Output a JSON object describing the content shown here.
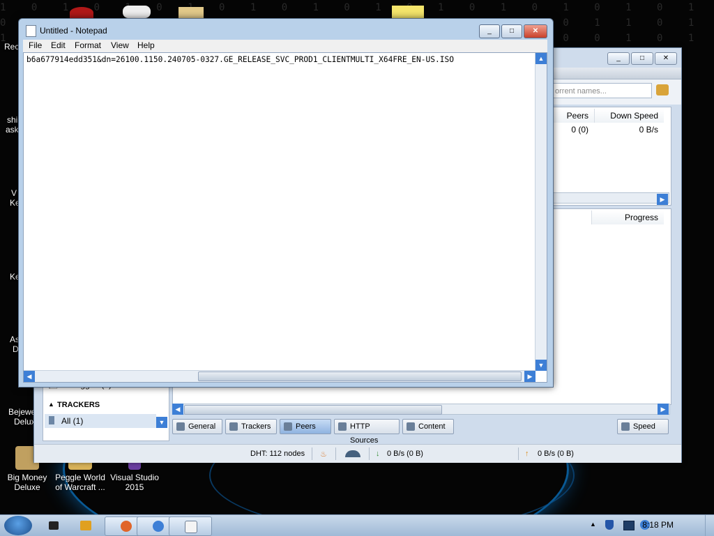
{
  "desktop": {
    "matrix_text": "1 0 1 0 1 0 1 0 1 0 1 0 1 0 1 0 1 0 1 0 1 0 1 0 1 0 1 0 1 0 1 0\n0 1 0 1 0 0 1 0 1 1 0 0 1 0 1 0 0 1 0 1 1 0 1 0 0 1 0 1 0 1 0 1\n1 0 1 1 0 1 0 0 1 0 1 0 1 1 0 1 0 1 0 0 1 0 1 0 1 0 1 1 0 1 0 0",
    "icons": [
      {
        "label": "Big Money\nDeluxe"
      },
      {
        "label": "Peggle World\nof Warcraft ..."
      },
      {
        "label": "Visual Studio\n2015"
      }
    ],
    "left_fragments": [
      "Rec",
      "shi",
      "ask",
      "V",
      "Ke",
      "Ke",
      "As",
      "D",
      "Bejewe",
      "Delux"
    ]
  },
  "notepad": {
    "title": "Untitled - Notepad",
    "menu": [
      "File",
      "Edit",
      "Format",
      "View",
      "Help"
    ],
    "content": "b6a677914edd351&dn=26100.1150.240705-0327.GE_RELEASE_SVC_PROD1_CLIENTMULTI_X64FRE_EN-US.ISO"
  },
  "torrent_client": {
    "search_placeholder": "orrent names...",
    "columns": {
      "peers": "Peers",
      "down_speed": "Down Speed"
    },
    "row": {
      "peers": "0 (0)",
      "down_speed": "0 B/s"
    },
    "detail_column": "Progress",
    "sidebar": {
      "untagged": "Untagged (1)",
      "trackers_header": "TRACKERS",
      "all": "All (1)"
    },
    "tabs": [
      "General",
      "Trackers",
      "Peers",
      "HTTP Sources",
      "Content"
    ],
    "speed_button": "Speed",
    "status": {
      "dht": "DHT: 112 nodes",
      "download": "0 B/s (0 B)",
      "upload": "0 B/s (0 B)"
    }
  },
  "taskbar": {
    "clock": "8:18 PM"
  }
}
